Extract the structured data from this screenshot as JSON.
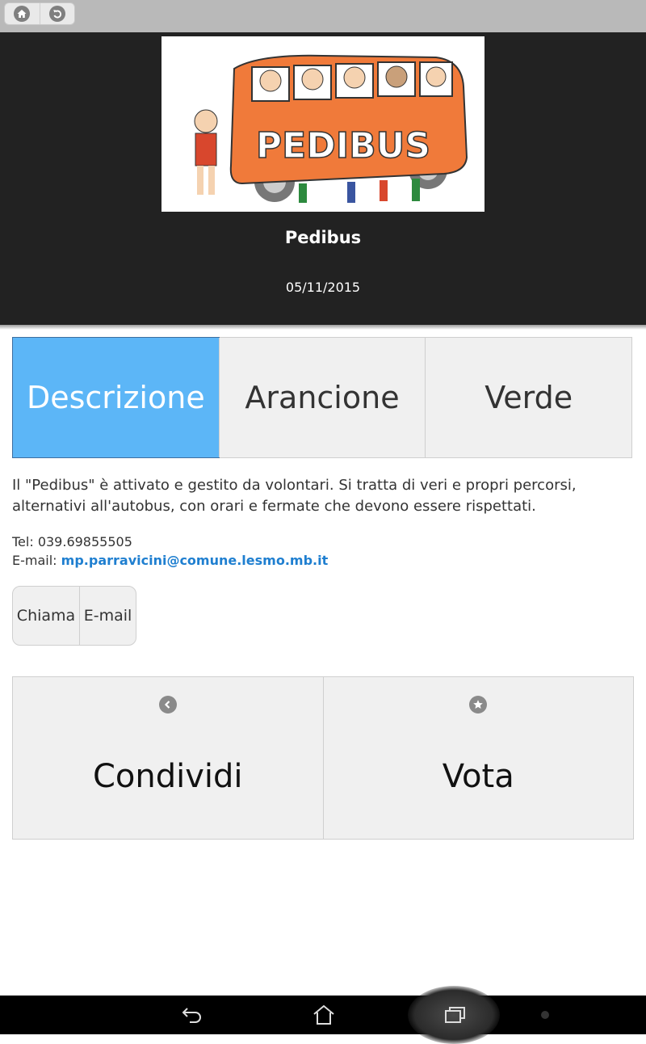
{
  "toolbar": {
    "home_icon": "home-icon",
    "back_icon": "undo-icon"
  },
  "header": {
    "logo_text": "PEDIBUS",
    "title": "Pedibus",
    "date": "05/11/2015"
  },
  "tabs": [
    {
      "label": "Descrizione",
      "active": true
    },
    {
      "label": "Arancione",
      "active": false
    },
    {
      "label": "Verde",
      "active": false
    }
  ],
  "content": {
    "description": "Il \"Pedibus\" è attivato e gestito da volontari. Si tratta di veri e propri percorsi, alternativi all'autobus, con orari e fermate che devono essere rispettati.",
    "tel_label": "Tel: 039.69855505",
    "email_label": "E-mail:",
    "email_value": "mp.parravicini@comune.lesmo.mb.it"
  },
  "actions": {
    "call": "Chiama",
    "email": "E-mail"
  },
  "buttons": {
    "share": {
      "label": "Condividi",
      "icon": "share-arrow-icon"
    },
    "vote": {
      "label": "Vota",
      "icon": "star-icon"
    }
  },
  "colors": {
    "active_tab": "#5cb6f7",
    "header_bg": "#222222",
    "link": "#1f7fd0"
  }
}
